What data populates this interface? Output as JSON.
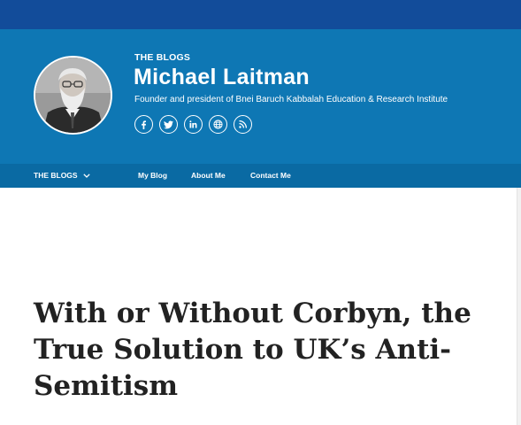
{
  "header": {
    "kicker": "THE BLOGS",
    "author_name": "Michael Laitman",
    "tagline": "Founder and president of Bnei Baruch Kabbalah Education & Research Institute",
    "socials": [
      {
        "icon": "facebook-icon"
      },
      {
        "icon": "twitter-icon"
      },
      {
        "icon": "linkedin-icon"
      },
      {
        "icon": "website-globe-icon"
      },
      {
        "icon": "rss-icon"
      }
    ]
  },
  "nav": {
    "blogs_label": "THE BLOGS",
    "my_blog": "My Blog",
    "about_me": "About Me",
    "contact_me": "Contact Me"
  },
  "article": {
    "title": "With or Without Corbyn, the True Solution to UK’s Anti-Semitism"
  },
  "colors": {
    "top_strip": "#124c9a",
    "header_bg": "#0e77b4",
    "nav_bg": "#0a6aa3",
    "title_text": "#222222"
  }
}
